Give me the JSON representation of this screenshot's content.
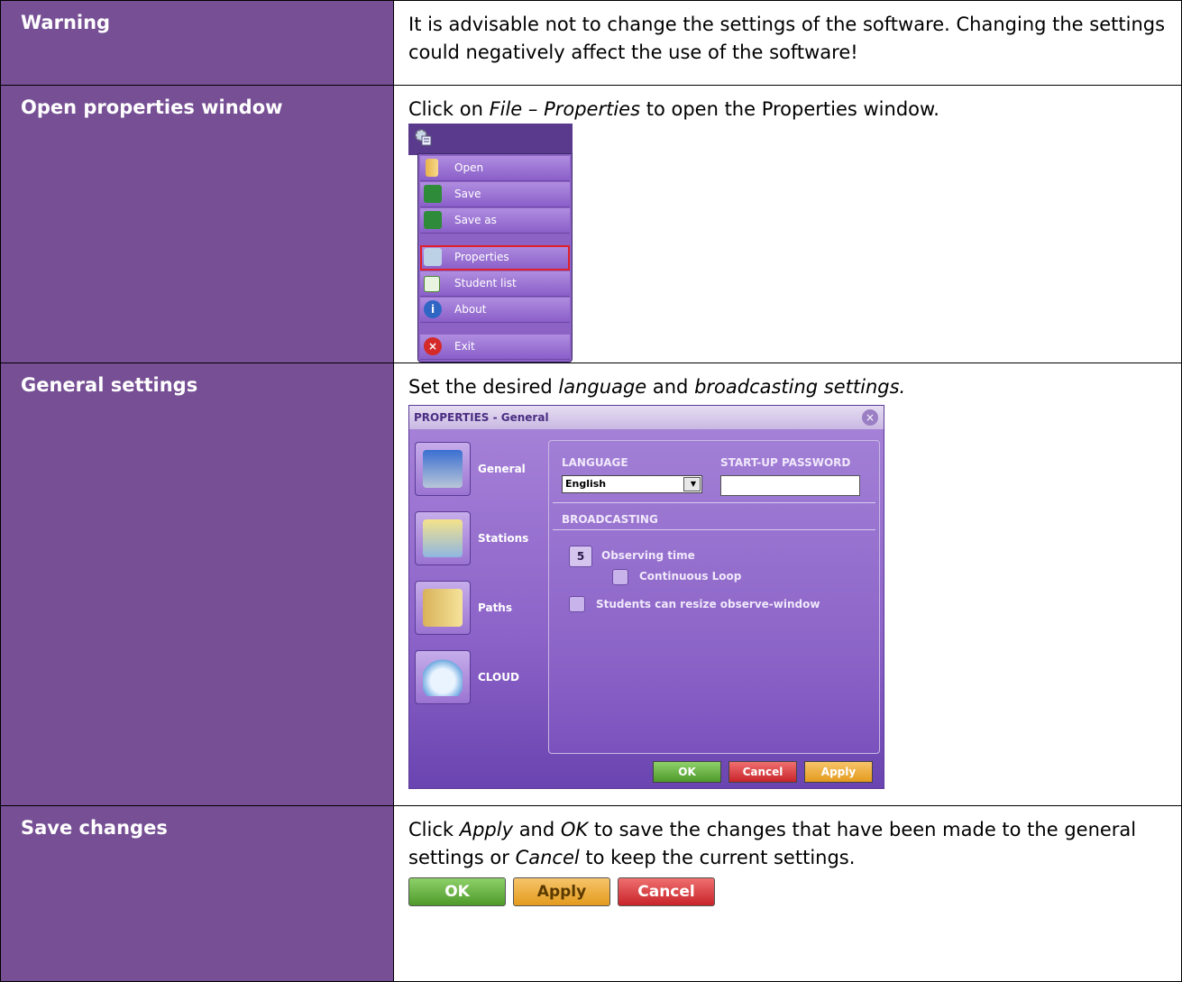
{
  "rows": [
    {
      "label": "Warning",
      "text": "It is advisable not to change the settings of the software. Changing the settings could negatively affect the use of the software!"
    },
    {
      "label": "Open properties window",
      "text_pre": "Click on ",
      "text_em": "File – Properties",
      "text_post": " to open the Properties window."
    },
    {
      "label": "General settings",
      "text_pre": "Set the desired ",
      "text_em1": "language",
      "text_mid": " and ",
      "text_em2": "broadcasting settings."
    },
    {
      "label": "Save changes",
      "text_pre": "Click ",
      "text_em1": "Apply",
      "text_mid1": " and ",
      "text_em2": "OK",
      "text_mid2": " to save the changes that have been made to the general settings or ",
      "text_em3": "Cancel",
      "text_post": " to keep the current settings."
    }
  ],
  "menu": {
    "items": [
      "Open",
      "Save",
      "Save as",
      "Properties",
      "Student list",
      "About",
      "Exit"
    ],
    "selected": "Properties"
  },
  "dialog": {
    "title": "PROPERTIES - General",
    "nav": [
      "General",
      "Stations",
      "Paths",
      "CLOUD"
    ],
    "language_label": "LANGUAGE",
    "language_value": "English",
    "password_label": "START-UP PASSWORD",
    "broadcasting_label": "BROADCASTING",
    "observing_value": "5",
    "observing_label": "Observing time",
    "loop_label": "Continuous Loop",
    "resize_label": "Students can resize observe-window",
    "ok": "OK",
    "cancel": "Cancel",
    "apply": "Apply"
  },
  "save_buttons": {
    "ok": "OK",
    "apply": "Apply",
    "cancel": "Cancel"
  },
  "colors": {
    "label_bg": "#764f94",
    "accent": "#8c62c4"
  }
}
